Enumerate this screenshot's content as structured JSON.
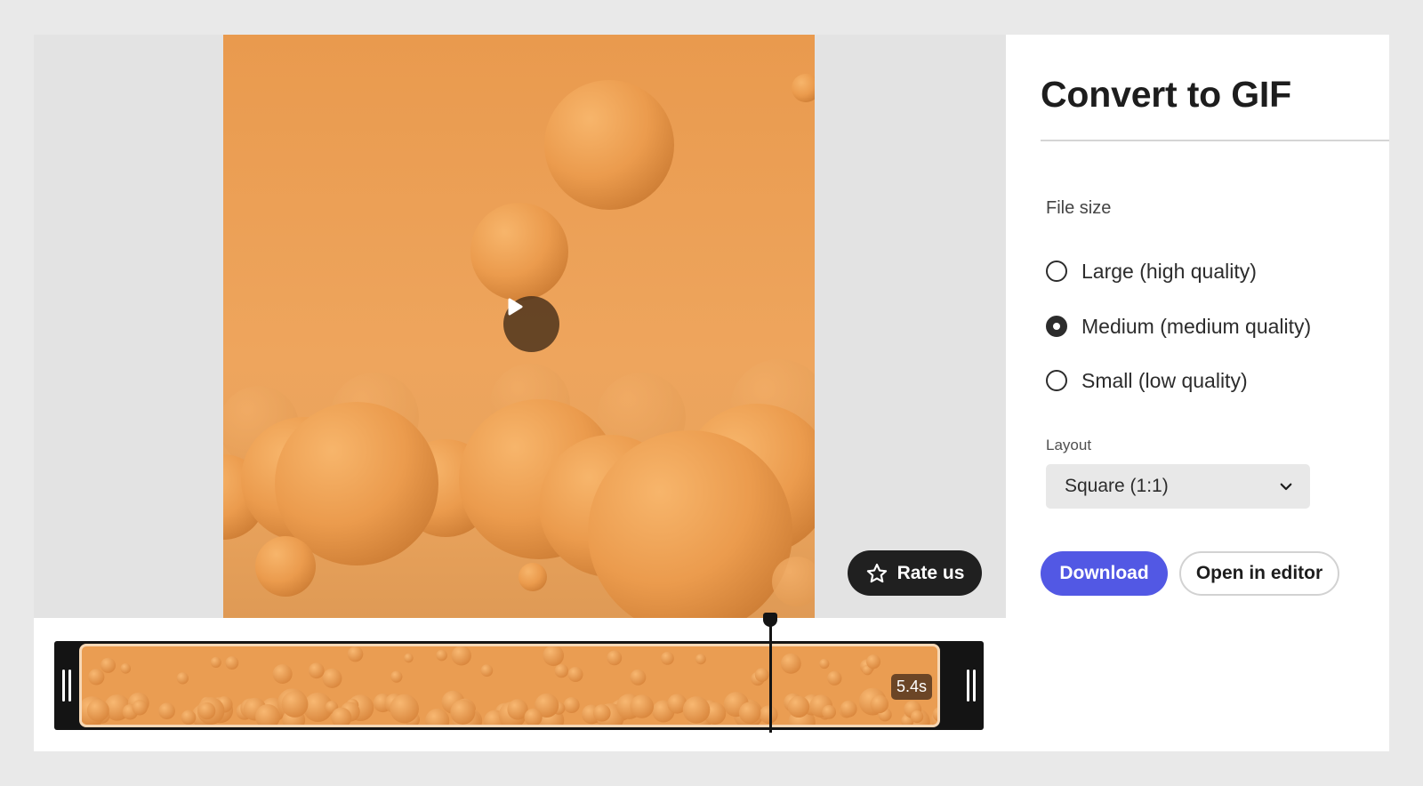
{
  "preview": {
    "play_icon": "play-icon",
    "rate_us": {
      "label": "Rate us",
      "icon": "star-icon"
    }
  },
  "timeline": {
    "duration": "5.4s",
    "playhead_position": 0.77,
    "handle_icon": "grip-icon"
  },
  "panel": {
    "title": "Convert to GIF",
    "file_size_label": "File size",
    "file_size_options": [
      {
        "label": "Large (high quality)",
        "selected": false
      },
      {
        "label": "Medium (medium quality)",
        "selected": true
      },
      {
        "label": "Small (low quality)",
        "selected": false
      }
    ],
    "layout_label": "Layout",
    "layout_value": "Square (1:1)",
    "layout_icon": "chevron-down-icon",
    "download_label": "Download",
    "open_in_editor_label": "Open in editor"
  },
  "colors": {
    "accent": "#5258e4",
    "video_orange": "#eea55d",
    "dark": "#202020"
  }
}
